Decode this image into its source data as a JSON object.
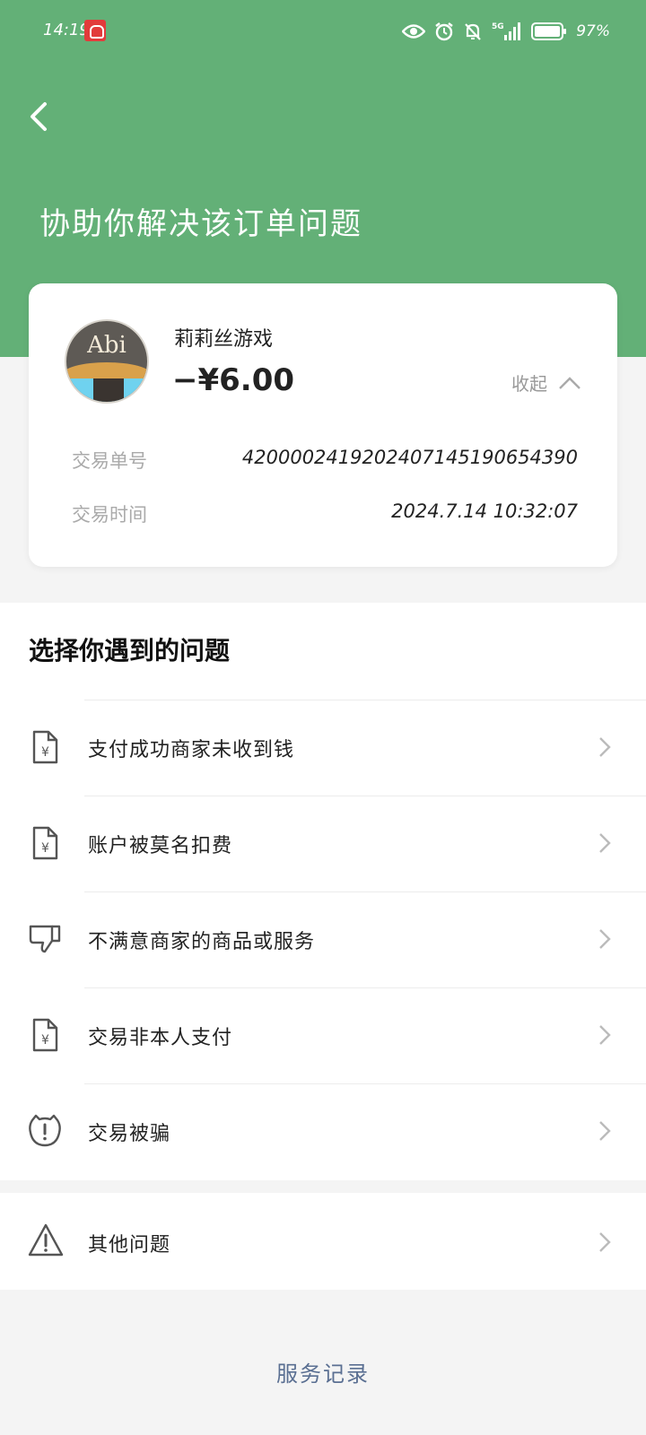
{
  "status_bar": {
    "time": "14:19",
    "network": "5G",
    "battery_percent": "97%"
  },
  "header": {
    "title": "协助你解决该订单问题"
  },
  "order": {
    "merchant": "莉莉丝游戏",
    "avatar_text": "Abi",
    "amount": "−¥6.00",
    "collapse_label": "收起",
    "details": [
      {
        "label": "交易单号",
        "value": "4200002419202407145190654390"
      },
      {
        "label": "交易时间",
        "value": "2024.7.14 10:32:07"
      }
    ]
  },
  "problems": {
    "section_title": "选择你遇到的问题",
    "items": [
      {
        "label": "支付成功商家未收到钱",
        "icon": "receipt-yen-icon"
      },
      {
        "label": "账户被莫名扣费",
        "icon": "receipt-yen-icon"
      },
      {
        "label": "不满意商家的商品或服务",
        "icon": "thumbs-down-icon"
      },
      {
        "label": "交易非本人支付",
        "icon": "receipt-yen-icon"
      },
      {
        "label": "交易被骗",
        "icon": "alert-face-icon"
      }
    ],
    "other": {
      "label": "其他问题",
      "icon": "warning-triangle-icon"
    }
  },
  "footer": {
    "service_record": "服务记录"
  },
  "colors": {
    "header_green": "#63b077",
    "link_blue": "#5a6f92"
  }
}
